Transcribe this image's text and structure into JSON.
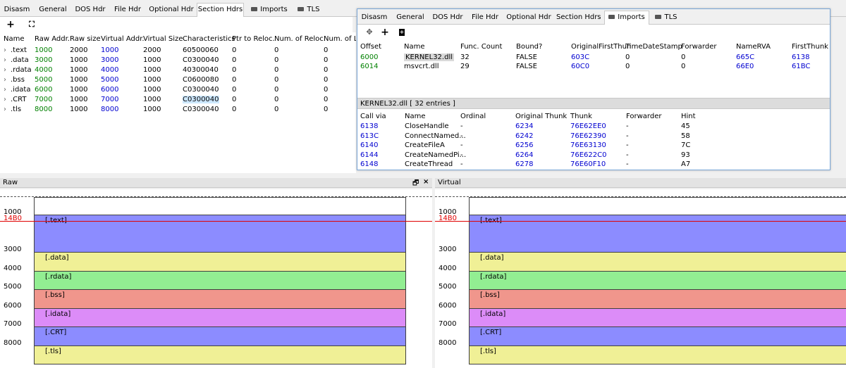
{
  "main_tabs": [
    "Disasm",
    "General",
    "DOS Hdr",
    "File Hdr",
    "Optional Hdr",
    "Section Hdrs",
    "Imports",
    "TLS"
  ],
  "section_table": {
    "columns": [
      "Name",
      "Raw Addr.",
      "Raw size",
      "Virtual Addr.",
      "Virtual Size",
      "Characteristics",
      "Ptr to Reloc.",
      "Num. of Reloc.",
      "Num. of Lin"
    ],
    "rows": [
      {
        "name": ".text",
        "raw": "1000",
        "rsize": "2000",
        "va": "1000",
        "vsize": "2000",
        "chars": "60500060",
        "ptr": "0",
        "nreloc": "0",
        "nlin": "0"
      },
      {
        "name": ".data",
        "raw": "3000",
        "rsize": "1000",
        "va": "3000",
        "vsize": "1000",
        "chars": "C0300040",
        "ptr": "0",
        "nreloc": "0",
        "nlin": "0"
      },
      {
        "name": ".rdata",
        "raw": "4000",
        "rsize": "1000",
        "va": "4000",
        "vsize": "1000",
        "chars": "40300040",
        "ptr": "0",
        "nreloc": "0",
        "nlin": "0"
      },
      {
        "name": ".bss",
        "raw": "5000",
        "rsize": "1000",
        "va": "5000",
        "vsize": "1000",
        "chars": "C0600080",
        "ptr": "0",
        "nreloc": "0",
        "nlin": "0"
      },
      {
        "name": ".idata",
        "raw": "6000",
        "rsize": "1000",
        "va": "6000",
        "vsize": "1000",
        "chars": "C0300040",
        "ptr": "0",
        "nreloc": "0",
        "nlin": "0"
      },
      {
        "name": ".CRT",
        "raw": "7000",
        "rsize": "1000",
        "va": "7000",
        "vsize": "1000",
        "chars": "C0300040",
        "ptr": "0",
        "nreloc": "0",
        "nlin": "0"
      },
      {
        "name": ".tls",
        "raw": "8000",
        "rsize": "1000",
        "va": "8000",
        "vsize": "1000",
        "chars": "C0300040",
        "ptr": "0",
        "nreloc": "0",
        "nlin": "0"
      }
    ]
  },
  "float_tabs": [
    "Disasm",
    "General",
    "DOS Hdr",
    "File Hdr",
    "Optional Hdr",
    "Section Hdrs",
    "Imports",
    "TLS"
  ],
  "imports": {
    "columns": [
      "Offset",
      "Name",
      "Func. Count",
      "Bound?",
      "OriginalFirstThun",
      "TimeDateStamp",
      "Forwarder",
      "NameRVA",
      "FirstThunk"
    ],
    "rows": [
      {
        "offset": "6000",
        "name": "KERNEL32.dll",
        "count": "32",
        "bound": "FALSE",
        "oft": "603C",
        "tds": "0",
        "fwd": "0",
        "namerva": "665C",
        "ft": "6138"
      },
      {
        "offset": "6014",
        "name": "msvcrt.dll",
        "count": "29",
        "bound": "FALSE",
        "oft": "60C0",
        "tds": "0",
        "fwd": "0",
        "namerva": "66E0",
        "ft": "61BC"
      }
    ]
  },
  "funcs": {
    "title": "KERNEL32.dll   [ 32 entries ]",
    "columns": [
      "Call via",
      "Name",
      "Ordinal",
      "Original Thunk",
      "Thunk",
      "Forwarder",
      "Hint"
    ],
    "rows": [
      {
        "callvia": "6138",
        "name": "CloseHandle",
        "ord": "-",
        "othunk": "6234",
        "thunk": "76E62EE0",
        "fwd": "-",
        "hint": "45"
      },
      {
        "callvia": "613C",
        "name": "ConnectNamed...",
        "ord": "-",
        "othunk": "6242",
        "thunk": "76E62390",
        "fwd": "-",
        "hint": "58"
      },
      {
        "callvia": "6140",
        "name": "CreateFileA",
        "ord": "-",
        "othunk": "6256",
        "thunk": "76E63130",
        "fwd": "-",
        "hint": "7C"
      },
      {
        "callvia": "6144",
        "name": "CreateNamedPi...",
        "ord": "-",
        "othunk": "6264",
        "thunk": "76E622C0",
        "fwd": "-",
        "hint": "93"
      },
      {
        "callvia": "6148",
        "name": "CreateThread",
        "ord": "-",
        "othunk": "6278",
        "thunk": "76E60F10",
        "fwd": "-",
        "hint": "A7"
      }
    ]
  },
  "raw_panel": {
    "title": "Raw",
    "float_icon": "restore-icon",
    "close_icon": "close-icon"
  },
  "virtual_panel": {
    "title": "Virtual"
  },
  "marker": "14B0",
  "ticks": [
    "1000",
    "3000",
    "4000",
    "5000",
    "6000",
    "7000",
    "8000"
  ],
  "sections": [
    {
      "label": "[.text]",
      "color": "#8c8cff"
    },
    {
      "label": "[.data]",
      "color": "#f0f096"
    },
    {
      "label": "[.rdata]",
      "color": "#92ee92"
    },
    {
      "label": "[.bss]",
      "color": "#f0968c"
    },
    {
      "label": "[.idata]",
      "color": "#dc8cf8"
    },
    {
      "label": "[.CRT]",
      "color": "#8c8cff"
    },
    {
      "label": "[.tls]",
      "color": "#f0f096"
    }
  ]
}
